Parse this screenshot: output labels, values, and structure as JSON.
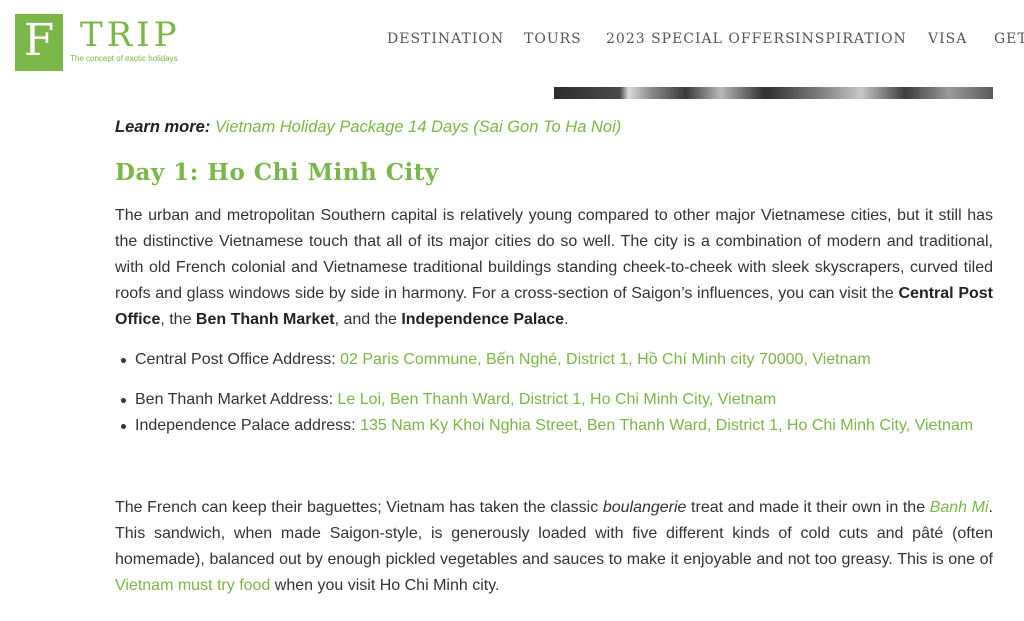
{
  "header": {
    "logo_letter": "F",
    "logo_word": "TRIP",
    "logo_tagline": "The concept of exotic holidays",
    "nav": [
      {
        "label": "DESTINATION"
      },
      {
        "label": "TOURS"
      },
      {
        "label": "2023 SPECIAL OFFERS"
      },
      {
        "label": "INSPIRATION"
      },
      {
        "label": "VISA"
      },
      {
        "label": "GET"
      }
    ]
  },
  "content": {
    "learn_more_label": "Learn more: ",
    "learn_more_link": "Vietnam Holiday Package 14 Days (Sai Gon To Ha Noi)",
    "day_heading": "Day 1: Ho Chi Minh City",
    "intro": {
      "text1": "The urban and metropolitan Southern capital is relatively young compared to other major Vietnamese cities, but it still has the distinctive Vietnamese touch that all of its major cities do so well. The city is a combination of modern and traditional, with old French colonial and Vietnamese traditional buildings standing cheek-to-cheek with sleek skyscrapers, curved tiled roofs and glass windows side by side in harmony. For a cross-section of Saigon’s influences, you can visit the ",
      "bold1": "Central Post Office",
      "text2": ", the ",
      "bold2": "Ben Thanh Market",
      "text3": ", and the ",
      "bold3": "Independence Palace",
      "text4": "."
    },
    "addresses": [
      {
        "label": "Central Post Office Address: ",
        "link": "02 Paris Commune, Bến Nghé, District 1, Hồ Chí Minh city 70000, Vietnam"
      },
      {
        "label": "Ben Thanh Market Address: ",
        "link": "Le Loi, Ben Thanh Ward, District 1, Ho Chi Minh City, Vietnam"
      },
      {
        "label": "Independence Palace address: ",
        "link": "135 Nam Ky Khoi Nghia Street, Ben Thanh Ward, District 1, Ho Chi Minh City, Vietnam"
      }
    ],
    "food": {
      "text1": "The French can keep their baguettes; Vietnam has taken the classic ",
      "italic": "boulangerie",
      "text2": " treat and made it their own in the ",
      "link1": "Banh Mi",
      "text3": ". This sandwich, when made Saigon-style, is generously loaded with five different kinds of cold cuts and pâté (often homemade), balanced out by enough pickled vegetables and sauces to make it enjoyable and not too greasy. This is one of ",
      "link2": "Vietnam must try food",
      "text4": " when you visit Ho Chi Minh city."
    }
  },
  "colors": {
    "accent": "#7ab648",
    "text": "#333333"
  }
}
